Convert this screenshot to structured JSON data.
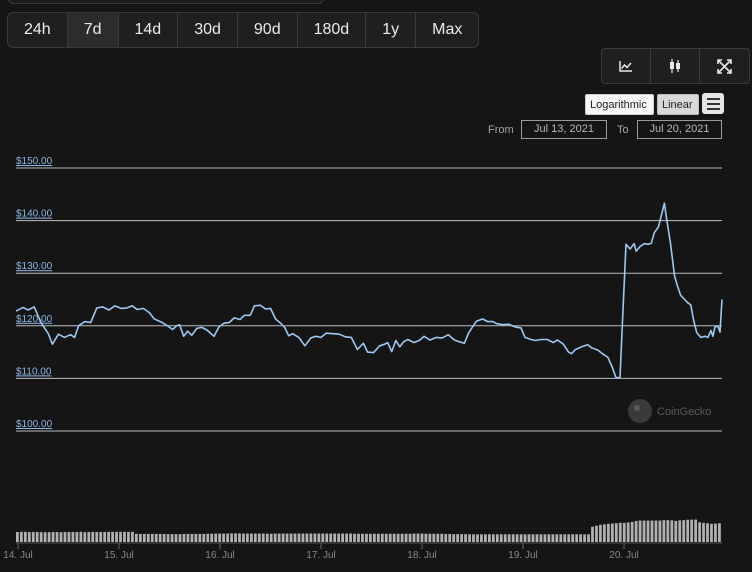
{
  "time_ranges": {
    "items": [
      "24h",
      "7d",
      "14d",
      "30d",
      "90d",
      "180d",
      "1y",
      "Max"
    ],
    "active": "7d"
  },
  "chart_types": {
    "line_icon": "line-chart-icon",
    "candle_icon": "candlestick-icon",
    "fullscreen_icon": "fullscreen-icon"
  },
  "scale": {
    "log_label": "Logarithmic",
    "linear_label": "Linear",
    "active": "Linear"
  },
  "date_range": {
    "from_label": "From",
    "from_value": "Jul 13, 2021",
    "to_label": "To",
    "to_value": "Jul 20, 2021"
  },
  "watermark": "CoinGecko",
  "colors": {
    "line": "#9ec8f2",
    "volume": "#b3b3b3",
    "grid": "#bdbdbd",
    "background": "#151515"
  },
  "chart_data": {
    "type": "line",
    "ylim": [
      100,
      150
    ],
    "yticks": [
      100,
      110,
      120,
      130,
      140,
      150
    ],
    "ytick_labels": [
      "$100.00",
      "$110.00",
      "$120.00",
      "$130.00",
      "$140.00",
      "$150.00"
    ],
    "x_tick_labels": [
      "14. Jul",
      "15. Jul",
      "16. Jul",
      "17. Jul",
      "18. Jul",
      "19. Jul",
      "20. Jul"
    ],
    "x_days": [
      0,
      1,
      2,
      3,
      4,
      5,
      6
    ],
    "x_range_days": [
      -0.02,
      6.97
    ],
    "series": [
      {
        "values": [
          [
            -0.02,
            122.8
          ],
          [
            0.05,
            123.5
          ],
          [
            0.1,
            123.0
          ],
          [
            0.16,
            123.6
          ],
          [
            0.23,
            120.5
          ],
          [
            0.3,
            118.5
          ],
          [
            0.34,
            116.5
          ],
          [
            0.4,
            118.4
          ],
          [
            0.46,
            117.8
          ],
          [
            0.52,
            118.3
          ],
          [
            0.56,
            117.8
          ],
          [
            0.6,
            120.0
          ],
          [
            0.66,
            120.8
          ],
          [
            0.72,
            120.6
          ],
          [
            0.78,
            123.4
          ],
          [
            0.84,
            123.6
          ],
          [
            0.9,
            123.0
          ],
          [
            0.96,
            123.8
          ],
          [
            1.02,
            123.3
          ],
          [
            1.08,
            123.4
          ],
          [
            1.13,
            123.8
          ],
          [
            1.18,
            123.1
          ],
          [
            1.24,
            123.3
          ],
          [
            1.3,
            122.5
          ],
          [
            1.35,
            121.3
          ],
          [
            1.42,
            120.7
          ],
          [
            1.48,
            120.0
          ],
          [
            1.53,
            119.3
          ],
          [
            1.57,
            120.0
          ],
          [
            1.6,
            120.2
          ],
          [
            1.64,
            118.0
          ],
          [
            1.68,
            119.0
          ],
          [
            1.72,
            118.2
          ],
          [
            1.77,
            119.5
          ],
          [
            1.82,
            119.7
          ],
          [
            1.87,
            119.2
          ],
          [
            1.94,
            118.0
          ],
          [
            1.99,
            119.8
          ],
          [
            2.04,
            120.5
          ],
          [
            2.09,
            120.6
          ],
          [
            2.14,
            121.5
          ],
          [
            2.2,
            121.2
          ],
          [
            2.24,
            122.0
          ],
          [
            2.3,
            122.0
          ],
          [
            2.34,
            123.8
          ],
          [
            2.4,
            123.9
          ],
          [
            2.45,
            123.2
          ],
          [
            2.5,
            123.3
          ],
          [
            2.55,
            121.3
          ],
          [
            2.6,
            120.5
          ],
          [
            2.64,
            119.7
          ],
          [
            2.68,
            118.1
          ],
          [
            2.72,
            118.5
          ],
          [
            2.78,
            117.8
          ],
          [
            2.84,
            116.2
          ],
          [
            2.9,
            117.7
          ],
          [
            2.95,
            118.0
          ],
          [
            3.0,
            117.8
          ],
          [
            3.05,
            118.6
          ],
          [
            3.12,
            118.5
          ],
          [
            3.18,
            118.4
          ],
          [
            3.24,
            117.9
          ],
          [
            3.3,
            117.8
          ],
          [
            3.36,
            115.5
          ],
          [
            3.42,
            116.7
          ],
          [
            3.46,
            115.0
          ],
          [
            3.52,
            114.9
          ],
          [
            3.58,
            116.2
          ],
          [
            3.63,
            116.5
          ],
          [
            3.66,
            116.8
          ],
          [
            3.7,
            115.1
          ],
          [
            3.74,
            117.2
          ],
          [
            3.78,
            116.0
          ],
          [
            3.82,
            117.0
          ],
          [
            3.86,
            117.4
          ],
          [
            3.92,
            116.8
          ],
          [
            3.98,
            117.3
          ],
          [
            4.02,
            118.0
          ],
          [
            4.08,
            117.3
          ],
          [
            4.14,
            117.8
          ],
          [
            4.2,
            117.7
          ],
          [
            4.26,
            118.3
          ],
          [
            4.32,
            117.3
          ],
          [
            4.38,
            116.9
          ],
          [
            4.42,
            116.7
          ],
          [
            4.46,
            118.6
          ],
          [
            4.5,
            119.8
          ],
          [
            4.54,
            120.9
          ],
          [
            4.6,
            121.3
          ],
          [
            4.65,
            120.8
          ],
          [
            4.7,
            120.8
          ],
          [
            4.74,
            120.4
          ],
          [
            4.8,
            120.2
          ],
          [
            4.86,
            120.3
          ],
          [
            4.92,
            119.8
          ],
          [
            4.98,
            119.6
          ],
          [
            5.02,
            117.8
          ],
          [
            5.08,
            117.4
          ],
          [
            5.12,
            117.2
          ],
          [
            5.18,
            117.4
          ],
          [
            5.24,
            117.4
          ],
          [
            5.3,
            116.8
          ],
          [
            5.34,
            117.3
          ],
          [
            5.4,
            116.5
          ],
          [
            5.45,
            115.0
          ],
          [
            5.48,
            114.7
          ],
          [
            5.52,
            115.5
          ],
          [
            5.58,
            116.0
          ],
          [
            5.64,
            116.4
          ],
          [
            5.68,
            115.8
          ],
          [
            5.74,
            115.4
          ],
          [
            5.78,
            114.8
          ],
          [
            5.84,
            114.0
          ],
          [
            5.88,
            112.3
          ],
          [
            5.92,
            110.2
          ],
          [
            5.94,
            110.1
          ],
          [
            5.96,
            110.2
          ],
          [
            5.99,
            123.0
          ],
          [
            6.02,
            135.5
          ],
          [
            6.06,
            134.6
          ],
          [
            6.1,
            135.6
          ],
          [
            6.12,
            134.2
          ],
          [
            6.16,
            135.1
          ],
          [
            6.2,
            135.6
          ],
          [
            6.24,
            135.5
          ],
          [
            6.27,
            135.7
          ],
          [
            6.3,
            137.7
          ],
          [
            6.34,
            138.8
          ],
          [
            6.37,
            141.0
          ],
          [
            6.4,
            143.3
          ],
          [
            6.42,
            140.6
          ],
          [
            6.46,
            135.7
          ],
          [
            6.5,
            129.5
          ],
          [
            6.53,
            127.5
          ],
          [
            6.56,
            125.8
          ],
          [
            6.6,
            125.0
          ],
          [
            6.63,
            124.4
          ],
          [
            6.66,
            124.0
          ],
          [
            6.69,
            121.0
          ],
          [
            6.72,
            118.7
          ],
          [
            6.76,
            117.8
          ],
          [
            6.8,
            118.0
          ],
          [
            6.83,
            117.8
          ],
          [
            6.86,
            119.1
          ],
          [
            6.88,
            118.0
          ],
          [
            6.9,
            119.8
          ],
          [
            6.93,
            119.9
          ],
          [
            6.95,
            118.8
          ],
          [
            6.97,
            125.0
          ]
        ]
      }
    ],
    "volume": {
      "values": [
        0.52,
        0.53,
        0.53,
        0.52,
        0.52,
        0.52,
        0.51,
        0.51,
        0.51,
        0.52,
        0.52,
        0.51,
        0.52,
        0.52,
        0.52,
        0.52,
        0.53,
        0.51,
        0.52,
        0.52,
        0.52,
        0.52,
        0.52,
        0.53,
        0.53,
        0.53,
        0.53,
        0.53,
        0.53,
        0.53,
        0.43,
        0.42,
        0.42,
        0.42,
        0.42,
        0.42,
        0.42,
        0.42,
        0.41,
        0.41,
        0.41,
        0.41,
        0.42,
        0.42,
        0.42,
        0.42,
        0.42,
        0.42,
        0.43,
        0.43,
        0.44,
        0.44,
        0.44,
        0.44,
        0.45,
        0.45,
        0.45,
        0.44,
        0.44,
        0.44,
        0.44,
        0.44,
        0.44,
        0.43,
        0.43,
        0.44,
        0.44,
        0.44,
        0.44,
        0.44,
        0.44,
        0.44,
        0.44,
        0.44,
        0.44,
        0.44,
        0.44,
        0.44,
        0.44,
        0.44,
        0.44,
        0.44,
        0.44,
        0.44,
        0.44,
        0.43,
        0.43,
        0.43,
        0.43,
        0.43,
        0.43,
        0.43,
        0.43,
        0.43,
        0.43,
        0.43,
        0.43,
        0.43,
        0.43,
        0.43,
        0.44,
        0.44,
        0.44,
        0.43,
        0.43,
        0.43,
        0.43,
        0.43,
        0.42,
        0.42,
        0.41,
        0.41,
        0.41,
        0.41,
        0.4,
        0.4,
        0.4,
        0.4,
        0.4,
        0.4,
        0.4,
        0.4,
        0.4,
        0.4,
        0.4,
        0.4,
        0.4,
        0.4,
        0.4,
        0.4,
        0.4,
        0.4,
        0.4,
        0.4,
        0.4,
        0.4,
        0.4,
        0.4,
        0.4,
        0.4,
        0.4,
        0.4,
        0.4,
        0.4,
        0.4,
        0.8,
        0.85,
        0.9,
        0.92,
        0.95,
        0.96,
        0.98,
        1.0,
        1.0,
        1.02,
        1.05,
        1.1,
        1.12,
        1.12,
        1.12,
        1.12,
        1.12,
        1.12,
        1.14,
        1.14,
        1.13,
        1.1,
        1.13,
        1.14,
        1.16,
        1.17,
        1.17,
        1.03,
        1.0,
        0.98,
        0.95,
        0.96,
        0.98
      ],
      "ylim": [
        0,
        1.2
      ]
    }
  }
}
